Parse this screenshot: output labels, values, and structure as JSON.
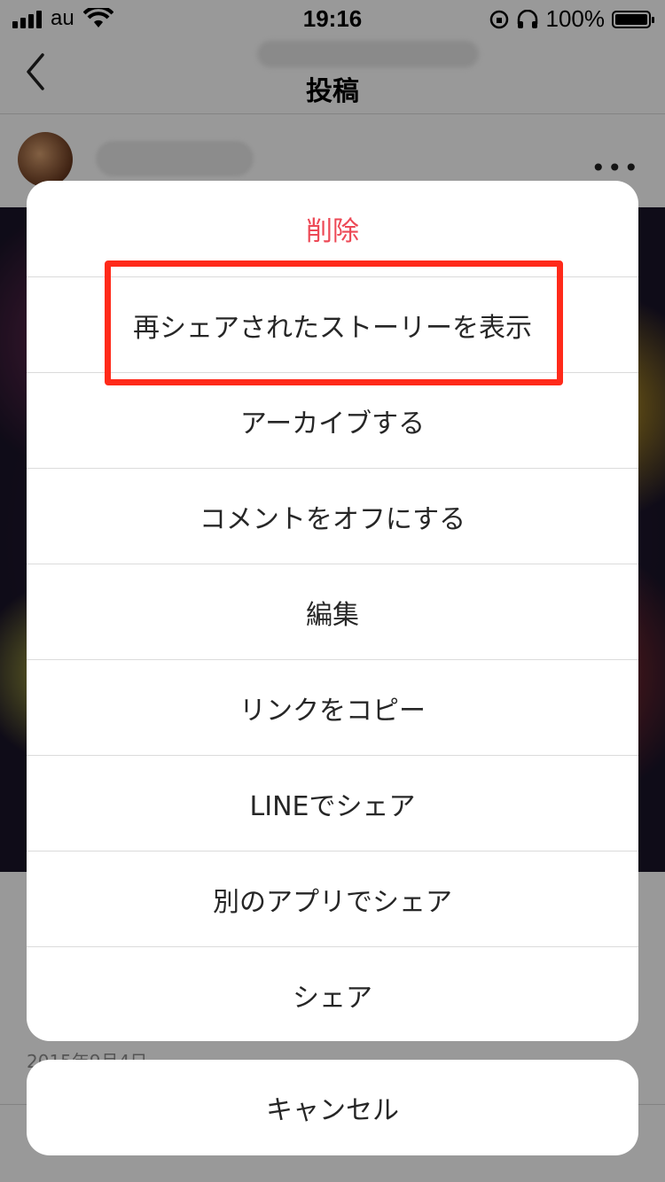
{
  "status_bar": {
    "carrier": "au",
    "time": "19:16",
    "battery": "100%"
  },
  "navbar": {
    "title": "投稿"
  },
  "post": {
    "date_partial": "2015年9月4日"
  },
  "action_sheet": {
    "items": [
      {
        "label": "削除",
        "style": "destructive"
      },
      {
        "label": "再シェアされたストーリーを表示"
      },
      {
        "label": "アーカイブする"
      },
      {
        "label": "コメントをオフにする"
      },
      {
        "label": "編集"
      },
      {
        "label": "リンクをコピー"
      },
      {
        "label": "LINEでシェア"
      },
      {
        "label": "別のアプリでシェア"
      },
      {
        "label": "シェア"
      }
    ],
    "cancel_label": "キャンセル"
  },
  "colors": {
    "destructive": "#ed4956",
    "highlight": "#ff2a1a",
    "text": "#262626"
  }
}
